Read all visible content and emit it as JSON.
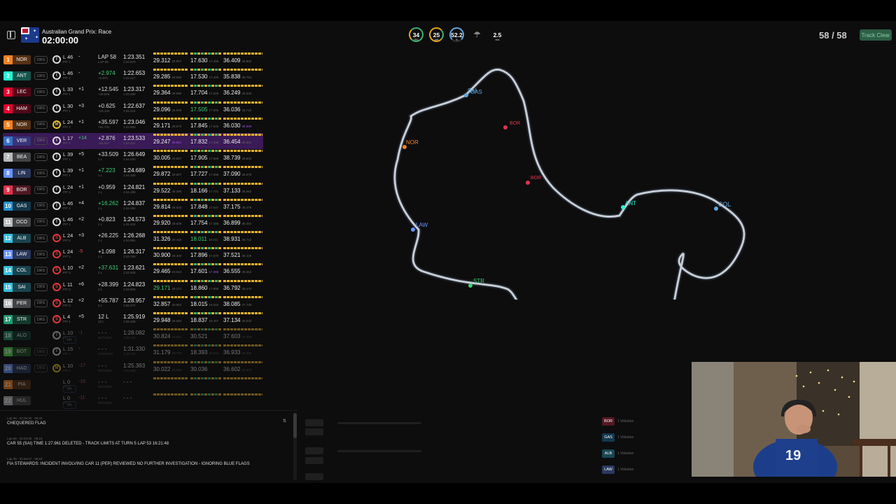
{
  "header": {
    "session_name": "Australian Grand Prix: Race",
    "clock": "02:00:00",
    "lap_count": "58 / 58",
    "track_status": "Track Clear"
  },
  "weather": [
    {
      "value": "34",
      "unit": "TRC",
      "icon": "track-temp-gauge"
    },
    {
      "value": "25",
      "unit": "AIR",
      "icon": "air-temp-gauge"
    },
    {
      "value": "52.2",
      "unit": "%",
      "icon": "humidity-gauge"
    },
    {
      "value": "",
      "unit": "",
      "icon": "rain-icon"
    },
    {
      "value": "2.5",
      "unit": "m/s",
      "icon": "wind-gauge"
    }
  ],
  "drivers": [
    {
      "pos": "1",
      "tla": "NOR",
      "color": "#f58020",
      "status": "DRS",
      "tyre": "I",
      "lap": "L 46",
      "pit": "PIT 1",
      "delta": "-",
      "gap": "LAP 58",
      "gap2": "LAP 58",
      "lt": "1:23.351",
      "lt2": "1:22.670",
      "s1": "29.312",
      "s1b": "28.857",
      "s2": "17.630",
      "s2b": "17.458",
      "s3": "36.409",
      "s3b": "35.862"
    },
    {
      "pos": "2",
      "tla": "ANT",
      "color": "#27f4d2",
      "status": "DRS",
      "tyre": "I",
      "lap": "L 46",
      "pit": "PIT 1",
      "delta": "-",
      "gap": "+2.974",
      "gap2": "+2.974",
      "lt": "1:22.653",
      "lt2": "1:22.417",
      "s1": "29.285",
      "s1b": "28.656",
      "s2": "17.530",
      "s2b": "17.490",
      "s3": "35.838",
      "s3b": "35.764",
      "gapcls": "green"
    },
    {
      "pos": "3",
      "tla": "LEC",
      "color": "#e8002d",
      "status": "DRS",
      "tyre": "I",
      "lap": "L 33",
      "pit": "PIT 1",
      "delta": "+1",
      "gap": "+12.545",
      "gap2": "+15.519",
      "lt": "1:23.317",
      "lt2": "1:22.459",
      "s1": "29.364",
      "s1b": "28.695",
      "s2": "17.704",
      "s2b": "17.529",
      "s3": "36.249",
      "s3b": "35.848"
    },
    {
      "pos": "4",
      "tla": "HAM",
      "color": "#e8002d",
      "status": "DRS",
      "tyre": "I",
      "lap": "L 30",
      "pit": "PIT 1",
      "delta": "+3",
      "gap": "+0.625",
      "gap2": "+16.144",
      "lt": "1:22.637",
      "lt2": "1:22.423",
      "s1": "29.096",
      "s1b": "28.906",
      "s2": "17.505",
      "s2b": "17.505",
      "s3": "36.036",
      "s3b": "35.716",
      "s2cls": "green"
    },
    {
      "pos": "5",
      "tla": "NOR",
      "color": "#f58020",
      "status": "DRS",
      "tyre": "M",
      "lap": "L 24",
      "pit": "PIT 2",
      "delta": "+1",
      "gap": "+35.597",
      "gap2": "+51.741",
      "lt": "1:23.046",
      "lt2": "1:22.983",
      "s1": "29.171",
      "s1b": "28.979",
      "s2": "17.845",
      "s2b": "17.646",
      "s3": "36.030",
      "s3b": "35.599",
      "s3bcls": "purple"
    },
    {
      "pos": "6",
      "tla": "VER",
      "color": "#3671c6",
      "status": "DRS",
      "tyre": "I",
      "lap": "L 17",
      "pit": "PIT 2",
      "delta": "+14",
      "gap": "+2.876",
      "gap2": "+54.617",
      "lt": "1:23.533",
      "lt2": "1:23.221",
      "s1": "29.247",
      "s1b": "28.881",
      "s2": "17.832",
      "s2b": "17.536",
      "s3": "36.454",
      "s3b": "35.652",
      "hl": true,
      "deltacls": "green",
      "s1bcls": "purple"
    },
    {
      "pos": "7",
      "tla": "BEA",
      "color": "#b6babd",
      "status": "DRS",
      "tyre": "I",
      "lap": "L 39",
      "pit": "PIT 1",
      "delta": "+5",
      "gap": "+33.509",
      "gap2": "1 L",
      "lt": "1:26.649",
      "lt2": "1:24.020",
      "s1": "30.005",
      "s1b": "29.567",
      "s2": "17.905",
      "s2b": "17.628",
      "s3": "38.739",
      "s3b": "36.825"
    },
    {
      "pos": "8",
      "tla": "LIN",
      "color": "#6692ff",
      "status": "DRS",
      "tyre": "I",
      "lap": "L 39",
      "pit": "PIT 1",
      "delta": "+1",
      "gap": "+7.223",
      "gap2": "1 L",
      "lt": "1:24.689",
      "lt2": "1:24.182",
      "s1": "29.872",
      "s1b": "29.507",
      "s2": "17.727",
      "s2b": "17.596",
      "s3": "37.090",
      "s3b": "36.678",
      "gapcls": "green"
    },
    {
      "pos": "9",
      "tla": "BOR",
      "color": "#e2334d",
      "status": "DRS",
      "tyre": "I",
      "lap": "L 24",
      "pit": "PIT 1",
      "delta": "+1",
      "gap": "+0.959",
      "gap2": "1 L",
      "lt": "1:24.821",
      "lt2": "1:24.198",
      "s1": "29.522",
      "s1b": "29.395",
      "s2": "18.166",
      "s2b": "17.721",
      "s3": "37.133",
      "s3b": "36.062"
    },
    {
      "pos": "10",
      "tla": "GAS",
      "color": "#2293d1",
      "status": "DRS",
      "tyre": "I",
      "lap": "L 46",
      "pit": "PIT 1",
      "delta": "+4",
      "gap": "+16.262",
      "gap2": "1 L",
      "lt": "1:24.837",
      "lt2": "1:24.182",
      "s1": "29.814",
      "s1b": "29.533",
      "s2": "17.848",
      "s2b": "17.647",
      "s3": "37.175",
      "s3b": "36.478",
      "gapcls": "green"
    },
    {
      "pos": "11",
      "tla": "OCO",
      "color": "#b6babd",
      "status": "DRS",
      "tyre": "I",
      "lap": "L 46",
      "pit": "PIT 1",
      "delta": "+2",
      "gap": "+0.823",
      "gap2": "1 L",
      "lt": "1:24.573",
      "lt2": "1:24.424",
      "s1": "29.920",
      "s1b": "29.628",
      "s2": "17.754",
      "s2b": "17.386",
      "s3": "36.899",
      "s3b": "36.354"
    },
    {
      "pos": "12",
      "tla": "ALB",
      "color": "#37bedd",
      "status": "DRS",
      "tyre": "S",
      "lap": "L 24",
      "pit": "PIT 2",
      "delta": "+3",
      "gap": "+26.225",
      "gap2": "1 L",
      "lt": "1:26.268",
      "lt2": "1:24.961",
      "s1": "31.326",
      "s1b": "29.418",
      "s2": "18.011",
      "s2b": "18.011",
      "s3": "38.931",
      "s3b": "36.742",
      "s2cls": "green"
    },
    {
      "pos": "13",
      "tla": "LAW",
      "color": "#6692ff",
      "status": "DRS",
      "tyre": "S",
      "lap": "L 24",
      "pit": "PIT 1",
      "delta": "-5",
      "gap": "+1.098",
      "gap2": "1 L",
      "lt": "1:26.317",
      "lt2": "1:23.793",
      "s1": "30.900",
      "s1b": "29.404",
      "s2": "17.896",
      "s2b": "17.678",
      "s3": "37.521",
      "s3b": "36.439",
      "deltacls": "red"
    },
    {
      "pos": "14",
      "tla": "COL",
      "color": "#37bedd",
      "status": "DRS",
      "tyre": "S",
      "lap": "L 10",
      "pit": "PIT 3",
      "delta": "+2",
      "gap": "+37.631",
      "gap2": "2 L",
      "lt": "1:23.621",
      "lt2": "1:22.926",
      "s1": "29.465",
      "s1b": "29.042",
      "s2": "17.601",
      "s2b": "17.386",
      "s3": "36.555",
      "s3b": "35.352",
      "gapcls": "green",
      "s2bcls": "purple"
    },
    {
      "pos": "15",
      "tla": "SAI",
      "color": "#37bedd",
      "status": "DRS",
      "tyre": "S",
      "lap": "L 11",
      "pit": "PIT 3",
      "delta": "+6",
      "gap": "+28.399",
      "gap2": "2 L",
      "lt": "1:24.823",
      "lt2": "1:23.609",
      "s1": "29.171",
      "s1b": "29.171",
      "s2": "18.860",
      "s2b": "17.806",
      "s3": "36.792",
      "s3b": "36.374",
      "s1cls": "green"
    },
    {
      "pos": "16",
      "tla": "PER",
      "color": "#b6babd",
      "status": "DRS",
      "tyre": "S",
      "lap": "L 12",
      "pit": "PIT 3",
      "delta": "+2",
      "gap": "+55.787",
      "gap2": "3 L",
      "lt": "1:28.957",
      "lt2": "1:26.077",
      "s1": "32.857",
      "s1b": "29.952",
      "s2": "18.015",
      "s2b": "18.015",
      "s3": "38.085",
      "s3b": "37.709"
    },
    {
      "pos": "17",
      "tla": "STR",
      "color": "#229971",
      "status": "DRS",
      "tyre": "S",
      "lap": "L 4",
      "pit": "PIT 4",
      "delta": "+5",
      "gap": "12 L",
      "gap2": "12 L",
      "lt": "1:25.919",
      "lt2": "1:25.189",
      "s1": "29.948",
      "s1b": "29.694",
      "s2": "18.837",
      "s2b": "18.467",
      "s3": "37.134",
      "s3b": "36.943"
    },
    {
      "pos": "18",
      "tla": "ALO",
      "color": "#229971",
      "status": "PIT",
      "tyre": "I",
      "lap": "L 10",
      "pit": "PIT 1",
      "delta": "-1",
      "gap": "- - -",
      "gap2": "RETIRED",
      "lt": "1:28.082",
      "lt2": "1:25.712",
      "s1": "30.824",
      "s1b": "29.893",
      "s2": "30.521",
      "s2b": "",
      "s3": "37.603",
      "s3b": "37.089",
      "dim": true,
      "deltacls": "red"
    },
    {
      "pos": "19",
      "tla": "BOT",
      "color": "#52e252",
      "status": "DRS",
      "tyre": "I",
      "lap": "L 15",
      "pit": "PIT 1",
      "delta": "-",
      "gap": "- - -",
      "gap2": "STOPPED",
      "lt": "1:31.330",
      "lt2": "1:25.172",
      "s1": "31.179",
      "s1b": "29.778",
      "s2": "18.393",
      "s2b": "18.042",
      "s3": "36.933",
      "s3b": "36.396",
      "dim": true
    },
    {
      "pos": "20",
      "tla": "HAD",
      "color": "#6692ff",
      "status": "DRS",
      "tyre": "M",
      "lap": "L 10",
      "pit": "PIT 0",
      "delta": "-17",
      "gap": "- - -",
      "gap2": "RETIRED",
      "lt": "1:25.363",
      "lt2": "1:25.363",
      "s1": "30.022",
      "s1b": "29.958",
      "s2": "30.036",
      "s2b": "",
      "s3": "36.602",
      "s3b": "36.602",
      "dim": true,
      "deltacls": "red"
    },
    {
      "pos": "21",
      "tla": "PIA",
      "color": "#f58020",
      "status": "PIT",
      "tyre": "",
      "lap": "L 0",
      "pit": "PIT 0",
      "delta": "-16",
      "gap": "- - -",
      "gap2": "RETIRED",
      "lt": "- - -",
      "lt2": "",
      "s1": "",
      "s1b": "",
      "s2": "",
      "s2b": "",
      "s3": "",
      "s3b": "",
      "dim": true,
      "deltacls": "red"
    },
    {
      "pos": "22",
      "tla": "HUL",
      "color": "#b6babd",
      "status": "PIT",
      "tyre": "",
      "lap": "L 0",
      "pit": "PIT 0",
      "delta": "-11",
      "gap": "- - -",
      "gap2": "RETIRED",
      "lt": "- - -",
      "lt2": "",
      "s1": "",
      "s1b": "",
      "s2": "",
      "s2b": "",
      "s3": "",
      "s3b": "",
      "dim": true,
      "deltacls": "red"
    }
  ],
  "map": {
    "labels": [
      {
        "text": "SAI",
        "color": "#5fa8e0"
      },
      {
        "text": "GAS",
        "color": "#5fa8e0"
      },
      {
        "text": "BOR",
        "color": "#e2334d"
      },
      {
        "text": "NOR",
        "color": "#f58020"
      },
      {
        "text": "BOR",
        "color": "#e2334d"
      },
      {
        "text": "ANT",
        "color": "#27f4d2"
      },
      {
        "text": "COL",
        "color": "#5fa8e0"
      },
      {
        "text": "LAW",
        "color": "#6692ff"
      },
      {
        "text": "STR",
        "color": "#3ccf6e"
      }
    ]
  },
  "race_control": [
    {
      "time": "Lap 58 · 02:26:33 · 06:26",
      "msg": "CHEQUERED FLAG"
    },
    {
      "time": "Lap 56 · 02:23:00 · 06:23",
      "msg": "CAR 55 (SAI) TIME 1:27.961 DELETED - TRACK LIMITS AT TURN 5 LAP 53 16:21:48"
    },
    {
      "time": "Lap 35 · 01:53:27 · 05:53",
      "msg": "FIA STEWARDS: INCIDENT INVOLVING CAR 11 (PER) REVIEWED NO FURTHER INVESTIGATION - IGNORING BLUE FLAGS"
    }
  ],
  "violations": [
    {
      "tla": "BOR",
      "color": "#e2334d",
      "text": "1 Violation"
    },
    {
      "tla": "GAS",
      "color": "#2293d1",
      "text": "1 Violation"
    },
    {
      "tla": "ALB",
      "color": "#37bedd",
      "text": "1 Violation"
    },
    {
      "tla": "LAW",
      "color": "#6692ff",
      "text": "1 Violation"
    }
  ]
}
